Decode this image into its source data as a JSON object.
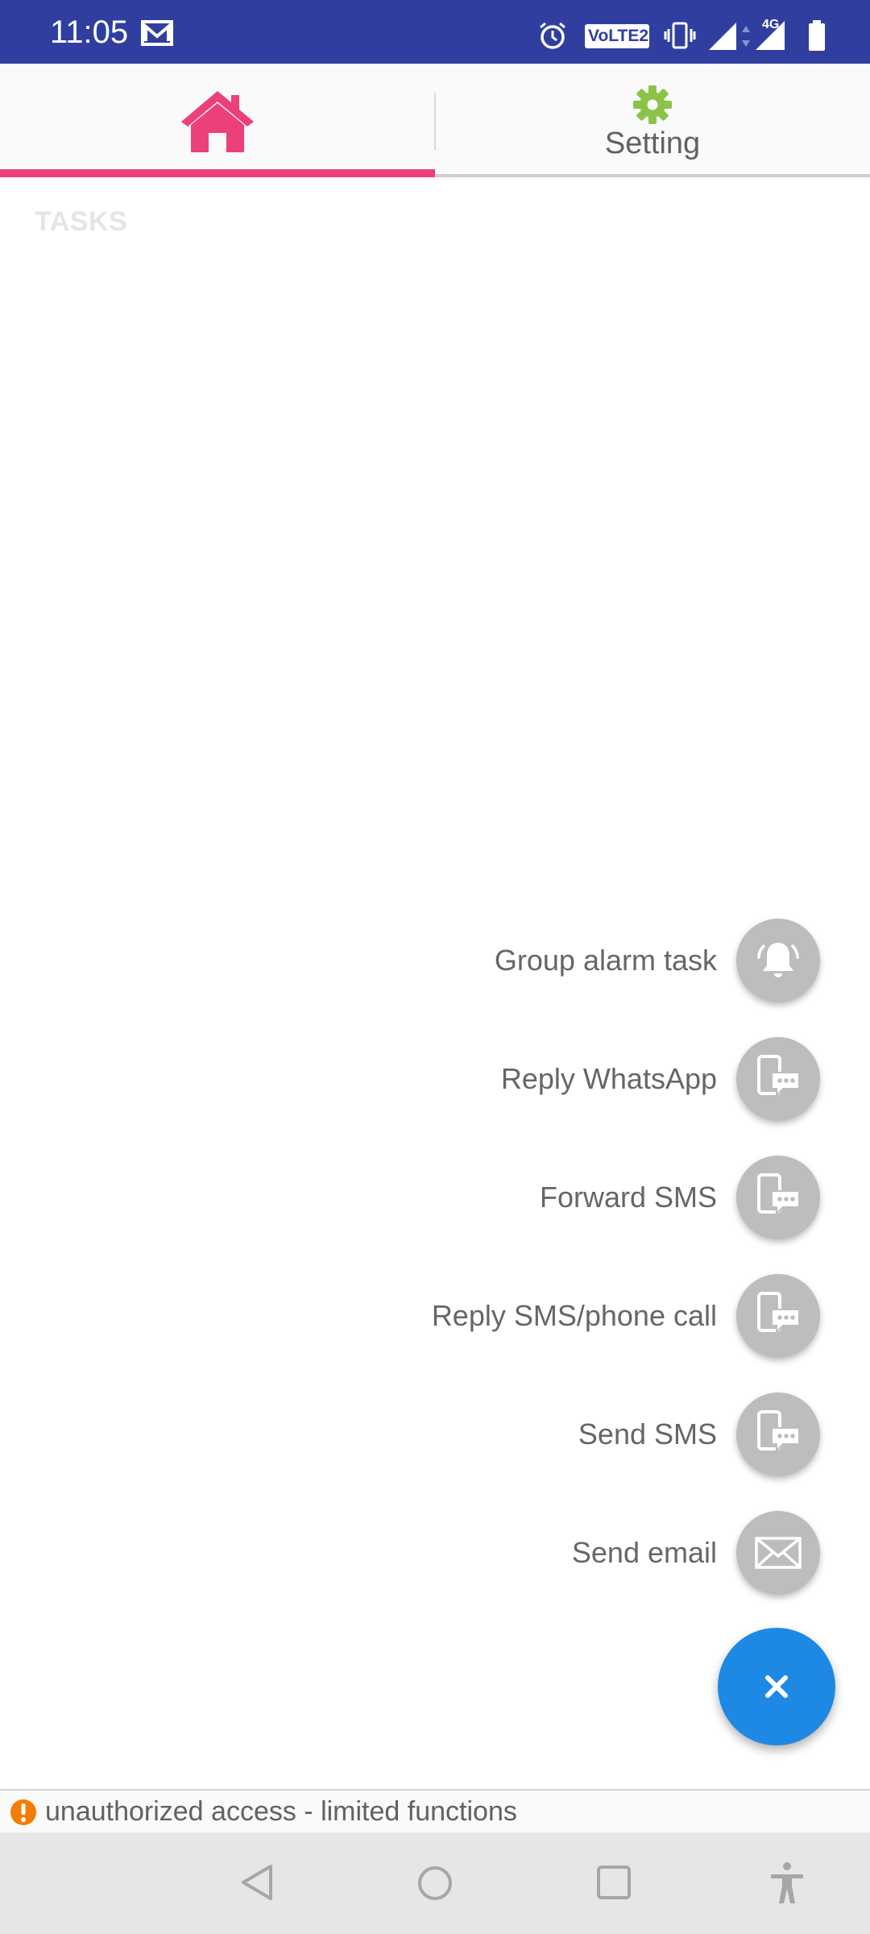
{
  "status_bar": {
    "time": "11:05",
    "icons": [
      "gmail-icon",
      "alarm-icon",
      "volte-icon",
      "vibrate-icon",
      "signal-icon",
      "4g-signal-icon",
      "battery-icon"
    ],
    "volte_label": "VoLTE2",
    "network_label": "4G",
    "background": "#303F9F"
  },
  "tabs": [
    {
      "name": "home",
      "icon": "home-icon",
      "label": "",
      "selected": true
    },
    {
      "name": "setting",
      "icon": "gear-icon",
      "label": "Setting",
      "selected": false
    }
  ],
  "colors": {
    "accent": "#EC407A",
    "gear": "#8BC34A",
    "fab": "#1E88E5",
    "mini_fab": "#BDBDBD",
    "warning": "#F57C00"
  },
  "tasks": {
    "header": "TASKS"
  },
  "speed_dial": {
    "actions": [
      {
        "label": "Group alarm task",
        "icon": "bell-icon"
      },
      {
        "label": "Reply WhatsApp",
        "icon": "phone-message-icon"
      },
      {
        "label": "Forward SMS",
        "icon": "phone-message-icon"
      },
      {
        "label": "Reply SMS/phone call",
        "icon": "phone-message-icon"
      },
      {
        "label": "Send SMS",
        "icon": "phone-message-icon"
      },
      {
        "label": "Send email",
        "icon": "envelope-icon"
      }
    ],
    "main_icon": "close-icon"
  },
  "warning": {
    "text": "unauthorized access - limited functions",
    "icon": "exclamation-icon"
  },
  "nav_bar": {
    "icons": [
      "back-icon",
      "home-circle-icon",
      "recents-icon",
      "accessibility-icon"
    ]
  }
}
